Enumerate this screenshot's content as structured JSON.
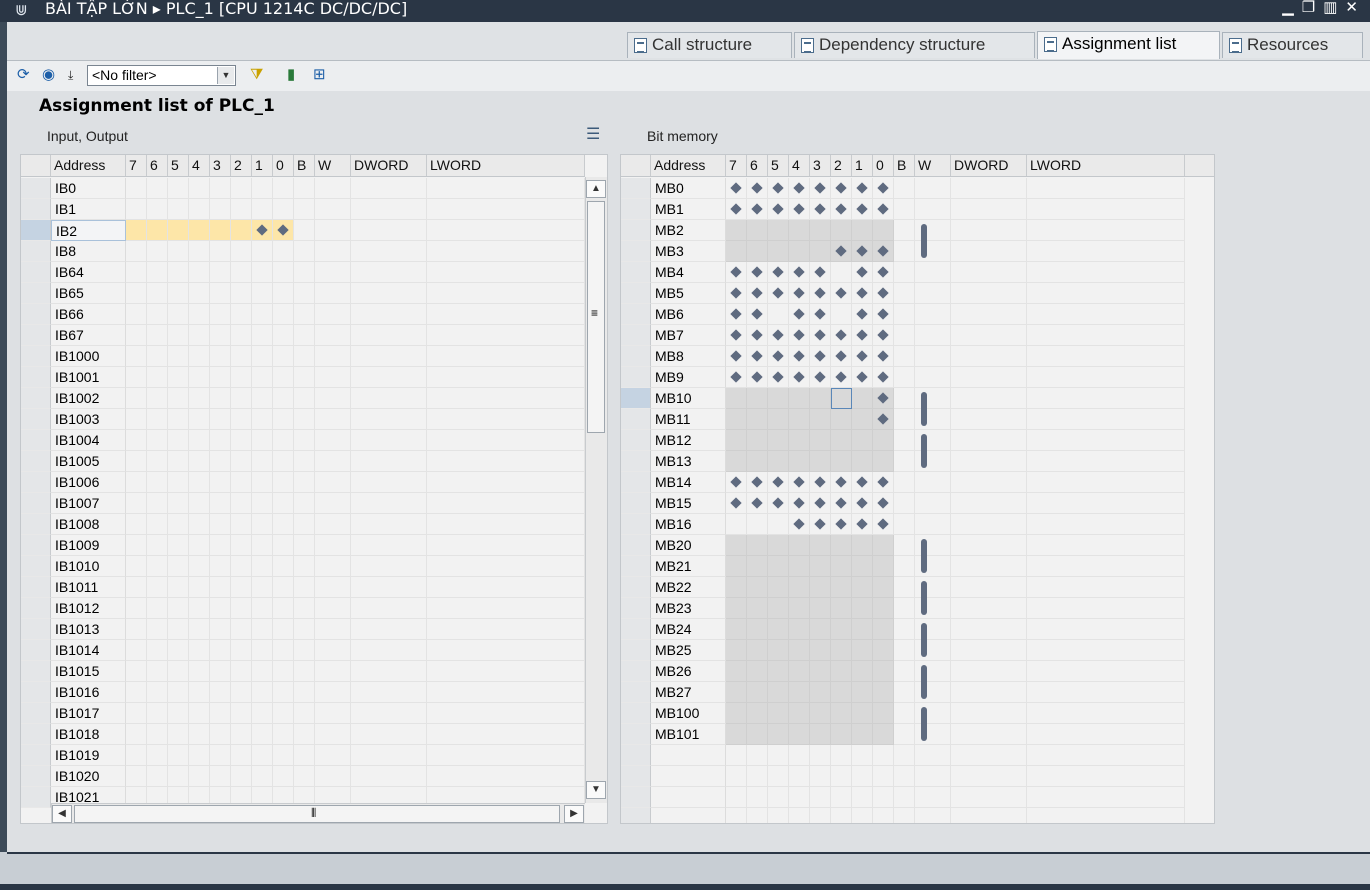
{
  "titlebar": {
    "title": "BÀI TẬP LỚN  ▸ PLC_1 [CPU 1214C DC/DC/DC]",
    "icon": "plc-icon",
    "window_buttons": [
      "minimize",
      "restore",
      "tile",
      "close"
    ]
  },
  "tabs": [
    {
      "label": "Call structure",
      "icon": "call-structure-icon",
      "active": false
    },
    {
      "label": "Dependency structure",
      "icon": "dependency-structure-icon",
      "active": false
    },
    {
      "label": "Assignment list",
      "icon": "assignment-list-icon",
      "active": true
    },
    {
      "label": "Resources",
      "icon": "resources-chart-icon",
      "active": false
    }
  ],
  "toolbar": {
    "filter_value": "<No filter>",
    "icons": [
      "refresh-icon",
      "show-hide-icon",
      "filter-funnel-icon",
      "used-addresses-icon",
      "free-addresses-icon"
    ]
  },
  "heading": "Assignment list of PLC_1",
  "io_panel": {
    "title": "Input, Output",
    "columns": [
      "Address",
      "7",
      "6",
      "5",
      "4",
      "3",
      "2",
      "1",
      "0",
      "B",
      "W",
      "DWORD",
      "LWORD"
    ],
    "rows": [
      {
        "address": "IB0",
        "bits": []
      },
      {
        "address": "IB1",
        "bits": []
      },
      {
        "address": "IB2",
        "bits": [
          1,
          0
        ],
        "highlight": true
      },
      {
        "address": "IB8",
        "bits": []
      },
      {
        "address": "IB64",
        "bits": []
      },
      {
        "address": "IB65",
        "bits": []
      },
      {
        "address": "IB66",
        "bits": []
      },
      {
        "address": "IB67",
        "bits": []
      },
      {
        "address": "IB1000",
        "bits": []
      },
      {
        "address": "IB1001",
        "bits": []
      },
      {
        "address": "IB1002",
        "bits": []
      },
      {
        "address": "IB1003",
        "bits": []
      },
      {
        "address": "IB1004",
        "bits": []
      },
      {
        "address": "IB1005",
        "bits": []
      },
      {
        "address": "IB1006",
        "bits": []
      },
      {
        "address": "IB1007",
        "bits": []
      },
      {
        "address": "IB1008",
        "bits": []
      },
      {
        "address": "IB1009",
        "bits": []
      },
      {
        "address": "IB1010",
        "bits": []
      },
      {
        "address": "IB1011",
        "bits": []
      },
      {
        "address": "IB1012",
        "bits": []
      },
      {
        "address": "IB1013",
        "bits": []
      },
      {
        "address": "IB1014",
        "bits": []
      },
      {
        "address": "IB1015",
        "bits": []
      },
      {
        "address": "IB1016",
        "bits": []
      },
      {
        "address": "IB1017",
        "bits": []
      },
      {
        "address": "IB1018",
        "bits": []
      },
      {
        "address": "IB1019",
        "bits": []
      },
      {
        "address": "IB1020",
        "bits": []
      },
      {
        "address": "IB1021",
        "bits": []
      }
    ]
  },
  "bit_panel": {
    "title": "Bit memory",
    "columns": [
      "Address",
      "7",
      "6",
      "5",
      "4",
      "3",
      "2",
      "1",
      "0",
      "B",
      "W",
      "DWORD",
      "LWORD"
    ],
    "rows": [
      {
        "address": "MB0",
        "bits": [
          7,
          6,
          5,
          4,
          3,
          2,
          1,
          0
        ],
        "grey": false,
        "word": ""
      },
      {
        "address": "MB1",
        "bits": [
          7,
          6,
          5,
          4,
          3,
          2,
          1,
          0
        ],
        "grey": false,
        "word": ""
      },
      {
        "address": "MB2",
        "bits": [],
        "grey": true,
        "word": "start"
      },
      {
        "address": "MB3",
        "bits": [
          2,
          1,
          0
        ],
        "grey": true,
        "word": "end"
      },
      {
        "address": "MB4",
        "bits": [
          7,
          6,
          5,
          4,
          3,
          1,
          0
        ],
        "grey": false,
        "word": ""
      },
      {
        "address": "MB5",
        "bits": [
          7,
          6,
          5,
          4,
          3,
          2,
          1,
          0
        ],
        "grey": false,
        "word": ""
      },
      {
        "address": "MB6",
        "bits": [
          7,
          6,
          4,
          3,
          1,
          0
        ],
        "grey": false,
        "word": ""
      },
      {
        "address": "MB7",
        "bits": [
          7,
          6,
          5,
          4,
          3,
          2,
          1,
          0
        ],
        "grey": false,
        "word": ""
      },
      {
        "address": "MB8",
        "bits": [
          7,
          6,
          5,
          4,
          3,
          2,
          1,
          0
        ],
        "grey": false,
        "word": ""
      },
      {
        "address": "MB9",
        "bits": [
          7,
          6,
          5,
          4,
          3,
          2,
          1,
          0
        ],
        "grey": false,
        "word": ""
      },
      {
        "address": "MB10",
        "bits": [
          0
        ],
        "grey": true,
        "word": "start",
        "focus_bit": 2
      },
      {
        "address": "MB11",
        "bits": [
          0
        ],
        "grey": true,
        "word": "end"
      },
      {
        "address": "MB12",
        "bits": [],
        "grey": true,
        "word": "start"
      },
      {
        "address": "MB13",
        "bits": [],
        "grey": true,
        "word": "end"
      },
      {
        "address": "MB14",
        "bits": [
          7,
          6,
          5,
          4,
          3,
          2,
          1,
          0
        ],
        "grey": false,
        "word": ""
      },
      {
        "address": "MB15",
        "bits": [
          7,
          6,
          5,
          4,
          3,
          2,
          1,
          0
        ],
        "grey": false,
        "word": ""
      },
      {
        "address": "MB16",
        "bits": [
          4,
          3,
          2,
          1,
          0
        ],
        "grey": false,
        "word": ""
      },
      {
        "address": "MB20",
        "bits": [],
        "grey": true,
        "word": "start"
      },
      {
        "address": "MB21",
        "bits": [],
        "grey": true,
        "word": "end"
      },
      {
        "address": "MB22",
        "bits": [],
        "grey": true,
        "word": "start"
      },
      {
        "address": "MB23",
        "bits": [],
        "grey": true,
        "word": "end"
      },
      {
        "address": "MB24",
        "bits": [],
        "grey": true,
        "word": "start"
      },
      {
        "address": "MB25",
        "bits": [],
        "grey": true,
        "word": "end"
      },
      {
        "address": "MB26",
        "bits": [],
        "grey": true,
        "word": "start"
      },
      {
        "address": "MB27",
        "bits": [],
        "grey": true,
        "word": "end"
      },
      {
        "address": "MB100",
        "bits": [],
        "grey": true,
        "word": "start"
      },
      {
        "address": "MB101",
        "bits": [],
        "grey": true,
        "word": "end"
      }
    ]
  },
  "colors": {
    "titlebar": "#2a3645",
    "highlight_row": "#fde6a8",
    "marker": "#5f6b80",
    "grey_cell": "#d9d9d9"
  }
}
